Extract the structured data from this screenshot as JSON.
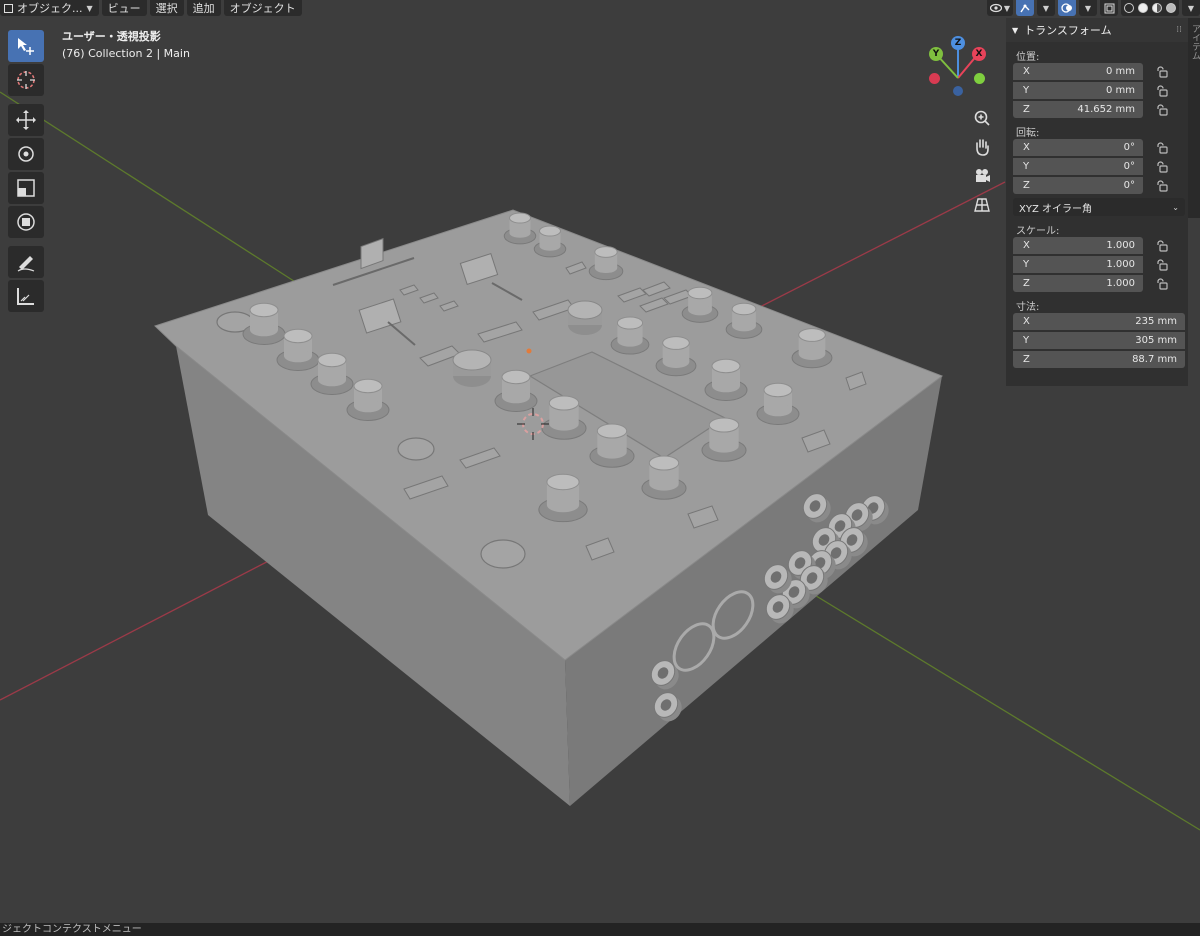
{
  "header": {
    "mode_label": "オブジェク...",
    "menu": [
      "ビュー",
      "選択",
      "追加",
      "オブジェクト"
    ]
  },
  "view_label": {
    "title": "ユーザー・透視投影",
    "subtitle": "(76) Collection 2 | Main"
  },
  "gizmo": {
    "x": "X",
    "y": "Y",
    "z": "Z"
  },
  "transform_panel": {
    "title": "トランスフォーム",
    "location_label": "位置:",
    "location": [
      {
        "axis": "X",
        "value": "0 mm"
      },
      {
        "axis": "Y",
        "value": "0 mm"
      },
      {
        "axis": "Z",
        "value": "41.652 mm"
      }
    ],
    "rotation_label": "回転:",
    "rotation": [
      {
        "axis": "X",
        "value": "0°"
      },
      {
        "axis": "Y",
        "value": "0°"
      },
      {
        "axis": "Z",
        "value": "0°"
      }
    ],
    "rotation_mode": "XYZ オイラー角",
    "scale_label": "スケール:",
    "scale": [
      {
        "axis": "X",
        "value": "1.000"
      },
      {
        "axis": "Y",
        "value": "1.000"
      },
      {
        "axis": "Z",
        "value": "1.000"
      }
    ],
    "dimensions_label": "寸法:",
    "dimensions": [
      {
        "axis": "X",
        "value": "235 mm"
      },
      {
        "axis": "Y",
        "value": "305 mm"
      },
      {
        "axis": "Z",
        "value": "88.7 mm"
      }
    ]
  },
  "status_bar": {
    "text": "ジェクトコンテクストメニュー"
  },
  "colors": {
    "viewport_bg": "#3d3d3d",
    "accent": "#4772b3",
    "x_axis": "#e8435a",
    "y_axis": "#7fbf3f",
    "z_axis": "#4d8fe0",
    "model": "#9a9a9a"
  }
}
